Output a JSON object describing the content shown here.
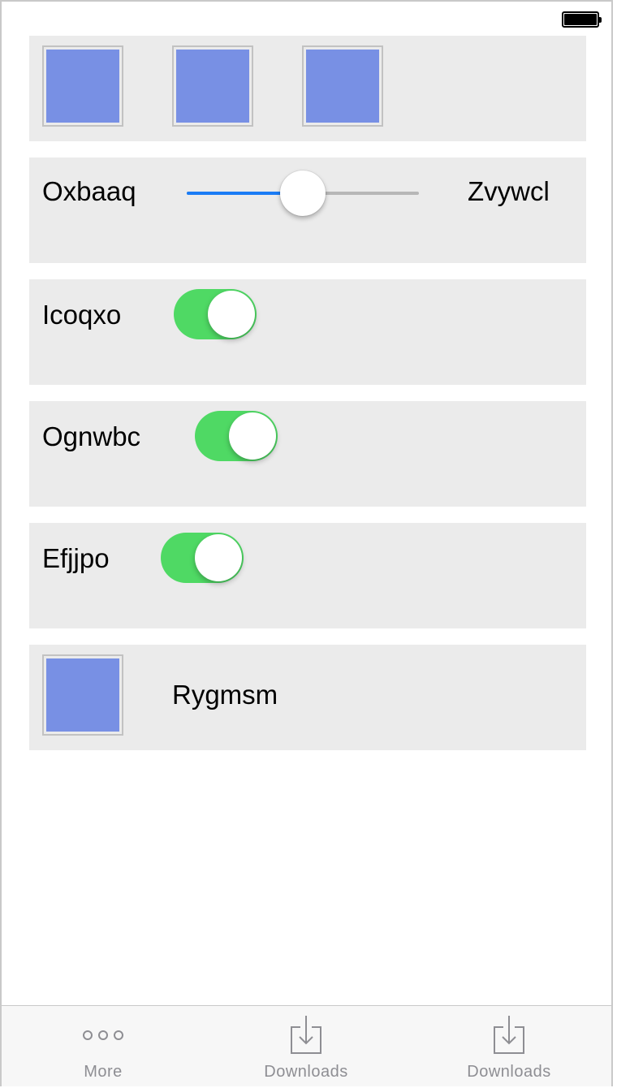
{
  "status_bar": {
    "battery_icon": "battery-full-icon"
  },
  "image_row": {
    "thumbnails": [
      {
        "icon": "image-thumbnail",
        "color": "#7890e4"
      },
      {
        "icon": "image-thumbnail",
        "color": "#7890e4"
      },
      {
        "icon": "image-thumbnail",
        "color": "#7890e4"
      }
    ]
  },
  "slider_row": {
    "left_label": "Oxbaaq",
    "right_label": "Zvywcl",
    "value": 0.5,
    "track_color": "#b7b7b7",
    "fill_color": "#1a7cf5"
  },
  "toggles": [
    {
      "label": "Icoqxo",
      "on": true
    },
    {
      "label": "Ognwbc",
      "on": true
    },
    {
      "label": "Efjjpo",
      "on": true
    }
  ],
  "toggle_on_color": "#4fd964",
  "image_label_row": {
    "label": "Rygmsm",
    "thumbnail_color": "#7890e4"
  },
  "tabbar": {
    "tabs": [
      {
        "label": "More",
        "icon": "more-dots-icon"
      },
      {
        "label": "Downloads",
        "icon": "download-tray-icon"
      },
      {
        "label": "Downloads",
        "icon": "download-tray-icon"
      }
    ]
  }
}
